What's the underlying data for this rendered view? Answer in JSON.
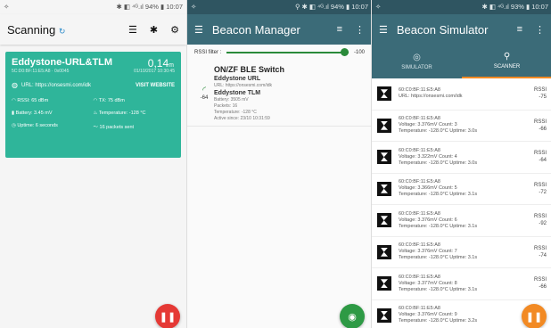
{
  "p1": {
    "status_left": "✧",
    "status_right": "✱ ◧ ⁴ᴳ.ıl 94% ▮ 10:07",
    "title": "Scanning",
    "refresh_icon": "↻",
    "eddystone": {
      "name": "Eddystone-URL&TLM",
      "distance": "0,14",
      "distance_unit": "m",
      "mac": "5C:D0:BF:11:E5:A8 · 0x0045",
      "time": "01/10/2017 10:30:45",
      "url": "URL: https://onsesmi.com/idk",
      "visit": "VISIT WEBSITE",
      "rssi": "RSSI: 65 dBm",
      "tx": "TX: 75 dBm",
      "battery": "Battery: 3.45 mV",
      "temp": "Temperature: -128 °C",
      "uptime": "Uptime: 6 seconds",
      "packets": "16 packets sent"
    }
  },
  "p2": {
    "status_left": "✧",
    "status_right": "⚲ ✱ ◧ ⁴ᴳ.ıl 94% ▮ 10:07",
    "title": "Beacon Manager",
    "filter_label": "RSSI filter :",
    "filter_value": "-100",
    "beacon": {
      "title": "ON/ZF BLE Switch",
      "rssi": "-64",
      "subtitle1": "Eddystone URL",
      "url": "URL: https://onsesmi.com/idk",
      "subtitle2": "Eddystone TLM",
      "tlm": [
        "Battery: 3505 mV",
        "Packets: 16",
        "Temperature: -128 °C",
        "Active since: 23/10 10:31:59"
      ]
    }
  },
  "p3": {
    "status_left": "✧",
    "status_right": "✱ ◧ ⁴ᴳ.ıl 93% ▮ 10:07",
    "title": "Beacon Simulator",
    "tab_simulator": "SIMULATOR",
    "tab_scanner": "SCANNER",
    "items": [
      {
        "mac": "60:C0:BF:11:E5:A8",
        "line2": "URL: https://onsesmi.com/idk",
        "line3": "",
        "rssi": "-75"
      },
      {
        "mac": "60:C0:BF:11:E5:A8",
        "line2": "Voltage: 3.376mV Count: 3",
        "line3": "Temperature: -128.0°C Uptime: 3.0s",
        "rssi": "-66"
      },
      {
        "mac": "60:C0:BF:11:E5:A8",
        "line2": "Voltage: 3.322mV Count: 4",
        "line3": "Temperature: -128.0°C Uptime: 3.0s",
        "rssi": "-64"
      },
      {
        "mac": "60:C0:BF:11:E5:A8",
        "line2": "Voltage: 3.366mV Count: 5",
        "line3": "Temperature: -128.0°C Uptime: 3.1s",
        "rssi": "-72"
      },
      {
        "mac": "60:C0:BF:11:E5:A8",
        "line2": "Voltage: 3.376mV Count: 6",
        "line3": "Temperature: -128.0°C Uptime: 3.1s",
        "rssi": "-92"
      },
      {
        "mac": "60:C0:BF:11:E5:A8",
        "line2": "Voltage: 3.376mV Count: 7",
        "line3": "Temperature: -128.0°C Uptime: 3.1s",
        "rssi": "-74"
      },
      {
        "mac": "60:C0:BF:11:E5:A8",
        "line2": "Voltage: 3.377mV Count: 8",
        "line3": "Temperature: -128.0°C Uptime: 3.1s",
        "rssi": "-66"
      },
      {
        "mac": "60:C0:BF:11:E5:A8",
        "line2": "Voltage: 3.376mV Count: 9",
        "line3": "Temperature: -128.0°C Uptime: 3.2s",
        "rssi": ""
      }
    ]
  },
  "colors": {
    "card": "#2fb59a",
    "appbar": "#3b6b78",
    "fab_red": "#e53935",
    "fab_green": "#2e9a45",
    "fab_orange": "#f28a24"
  },
  "icons": {
    "pause": "pause-icon",
    "filter": "filter-icon",
    "menu": "menu-icon",
    "bluetooth": "bluetooth-icon",
    "settings": "gear-icon"
  }
}
